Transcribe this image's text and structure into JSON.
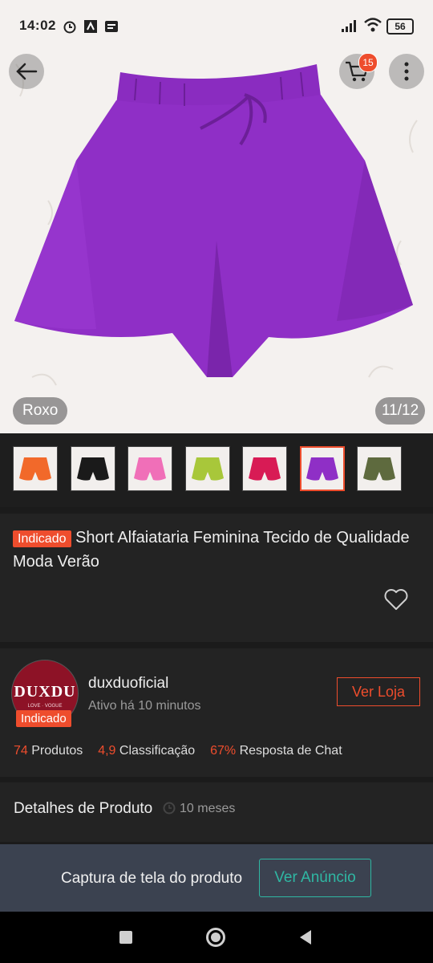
{
  "status_bar": {
    "time": "14:02",
    "battery": "56"
  },
  "hero": {
    "variant_label": "Roxo",
    "image_counter": "11/12",
    "cart_count": "15"
  },
  "thumbnails": [
    {
      "color": "#f2692a"
    },
    {
      "color": "#1a1a1a"
    },
    {
      "color": "#f06fb8"
    },
    {
      "color": "#a8c73a"
    },
    {
      "color": "#d81b55"
    },
    {
      "color": "#8f2fc6"
    },
    {
      "color": "#5e6a3e"
    }
  ],
  "product": {
    "badge": "Indicado",
    "title": "Short Alfaiataria Feminina Tecido de Qualidade  Moda Verão"
  },
  "shop": {
    "logo_text": "DUXDU",
    "logo_sub": "LOVE · VOGUE",
    "badge": "Indicado",
    "name": "duxduoficial",
    "active": "Ativo há 10 minutos",
    "visit_button": "Ver Loja",
    "stats": {
      "products_value": "74",
      "products_label": "Produtos",
      "rating_value": "4,9",
      "rating_label": "Classificação",
      "chat_value": "67%",
      "chat_label": "Resposta de Chat"
    }
  },
  "details": {
    "title": "Detalhes de Produto",
    "age": "10 meses"
  },
  "capture": {
    "text": "Captura de tela do produto",
    "button": "Ver Anúncio"
  },
  "colors": {
    "accent": "#ee4d2d",
    "teal": "#2fb7a3",
    "product": "#8f2fc6"
  }
}
